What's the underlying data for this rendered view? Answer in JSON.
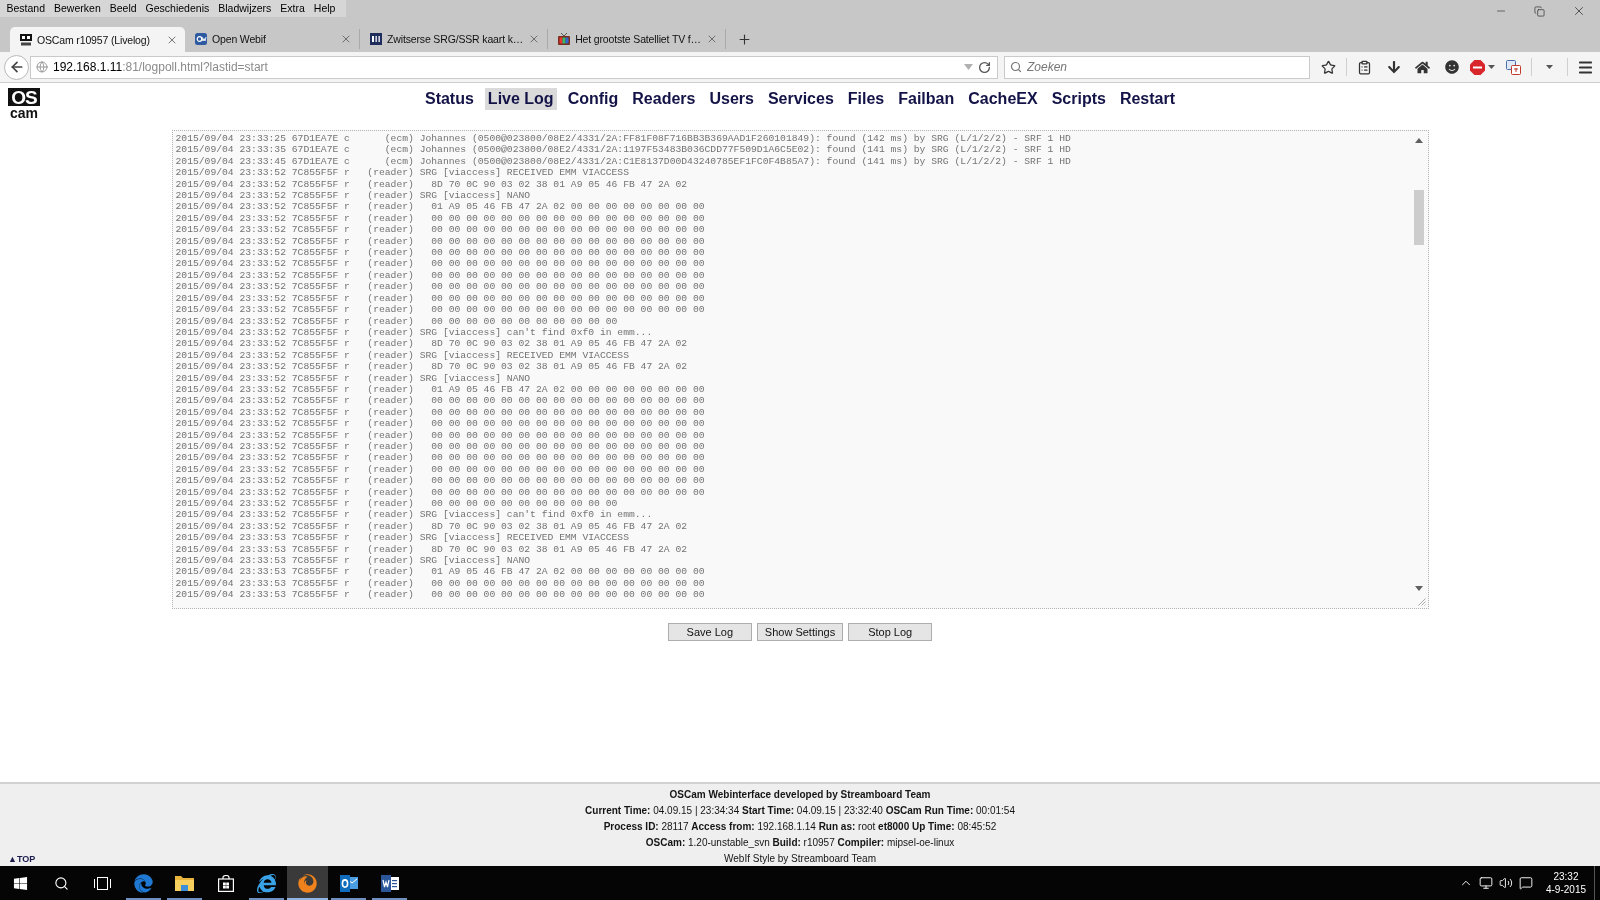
{
  "menu_bar": [
    "Bestand",
    "Bewerken",
    "Beeld",
    "Geschiedenis",
    "Bladwijzers",
    "Extra",
    "Help"
  ],
  "tabs": [
    {
      "title": "OSCam r10957 (Livelog)",
      "kind": "oscam",
      "selected": true
    },
    {
      "title": "Open Webif",
      "kind": "webif",
      "selected": false
    },
    {
      "title": "Zwitserse SRG/SSR kaart k…",
      "kind": "pli",
      "selected": false
    },
    {
      "title": "Het grootste Satelliet TV f…",
      "kind": "tv",
      "selected": false
    }
  ],
  "address_bar": {
    "host": "192.168.1.11",
    "rest": ":81/logpoll.html?lastid=start"
  },
  "search": {
    "placeholder": "Zoeken"
  },
  "logo": {
    "top": "OS",
    "bottom": "cam"
  },
  "nav": [
    {
      "label": "Status",
      "selected": false
    },
    {
      "label": "Live Log",
      "selected": true
    },
    {
      "label": "Config",
      "selected": false
    },
    {
      "label": "Readers",
      "selected": false
    },
    {
      "label": "Users",
      "selected": false
    },
    {
      "label": "Services",
      "selected": false
    },
    {
      "label": "Files",
      "selected": false
    },
    {
      "label": "Failban",
      "selected": false
    },
    {
      "label": "CacheEX",
      "selected": false
    },
    {
      "label": "Scripts",
      "selected": false
    },
    {
      "label": "Restart",
      "selected": false
    }
  ],
  "log": {
    "lines": [
      "2015/09/04 23:33:25 67D1EA7E c      (ecm) Johannes (0500@023800/08E2/4331/2A:FF81F08F716BB3B369AAD1F260101849): found (142 ms) by SRG (L/1/2/2) - SRF 1 HD",
      "2015/09/04 23:33:35 67D1EA7E c      (ecm) Johannes (0500@023800/08E2/4331/2A:1197F53483B036CDD77F509D1A6C5E02): found (141 ms) by SRG (L/1/2/2) - SRF 1 HD",
      "2015/09/04 23:33:45 67D1EA7E c      (ecm) Johannes (0500@023800/08E2/4331/2A:C1E8137D00D43240785EF1FC0F4B85A7): found (141 ms) by SRG (L/1/2/2) - SRF 1 HD",
      "2015/09/04 23:33:52 7C855F5F r   (reader) SRG [viaccess] RECEIVED EMM VIACCESS",
      "2015/09/04 23:33:52 7C855F5F r   (reader)   8D 70 0C 90 03 02 38 01 A9 05 46 FB 47 2A 02",
      "2015/09/04 23:33:52 7C855F5F r   (reader) SRG [viaccess] NANO",
      "2015/09/04 23:33:52 7C855F5F r   (reader)   01 A9 05 46 FB 47 2A 02 00 00 00 00 00 00 00 00",
      "2015/09/04 23:33:52 7C855F5F r   (reader)   00 00 00 00 00 00 00 00 00 00 00 00 00 00 00 00",
      "2015/09/04 23:33:52 7C855F5F r   (reader)   00 00 00 00 00 00 00 00 00 00 00 00 00 00 00 00",
      "2015/09/04 23:33:52 7C855F5F r   (reader)   00 00 00 00 00 00 00 00 00 00 00 00 00 00 00 00",
      "2015/09/04 23:33:52 7C855F5F r   (reader)   00 00 00 00 00 00 00 00 00 00 00 00 00 00 00 00",
      "2015/09/04 23:33:52 7C855F5F r   (reader)   00 00 00 00 00 00 00 00 00 00 00 00 00 00 00 00",
      "2015/09/04 23:33:52 7C855F5F r   (reader)   00 00 00 00 00 00 00 00 00 00 00 00 00 00 00 00",
      "2015/09/04 23:33:52 7C855F5F r   (reader)   00 00 00 00 00 00 00 00 00 00 00 00 00 00 00 00",
      "2015/09/04 23:33:52 7C855F5F r   (reader)   00 00 00 00 00 00 00 00 00 00 00 00 00 00 00 00",
      "2015/09/04 23:33:52 7C855F5F r   (reader)   00 00 00 00 00 00 00 00 00 00 00 00 00 00 00 00",
      "2015/09/04 23:33:52 7C855F5F r   (reader)   00 00 00 00 00 00 00 00 00 00 00",
      "2015/09/04 23:33:52 7C855F5F r   (reader) SRG [viaccess] can't find 0xf0 in emm...",
      "2015/09/04 23:33:52 7C855F5F r   (reader)   8D 70 0C 90 03 02 38 01 A9 05 46 FB 47 2A 02",
      "2015/09/04 23:33:52 7C855F5F r   (reader) SRG [viaccess] RECEIVED EMM VIACCESS",
      "2015/09/04 23:33:52 7C855F5F r   (reader)   8D 70 0C 90 03 02 38 01 A9 05 46 FB 47 2A 02",
      "2015/09/04 23:33:52 7C855F5F r   (reader) SRG [viaccess] NANO",
      "2015/09/04 23:33:52 7C855F5F r   (reader)   01 A9 05 46 FB 47 2A 02 00 00 00 00 00 00 00 00",
      "2015/09/04 23:33:52 7C855F5F r   (reader)   00 00 00 00 00 00 00 00 00 00 00 00 00 00 00 00",
      "2015/09/04 23:33:52 7C855F5F r   (reader)   00 00 00 00 00 00 00 00 00 00 00 00 00 00 00 00",
      "2015/09/04 23:33:52 7C855F5F r   (reader)   00 00 00 00 00 00 00 00 00 00 00 00 00 00 00 00",
      "2015/09/04 23:33:52 7C855F5F r   (reader)   00 00 00 00 00 00 00 00 00 00 00 00 00 00 00 00",
      "2015/09/04 23:33:52 7C855F5F r   (reader)   00 00 00 00 00 00 00 00 00 00 00 00 00 00 00 00",
      "2015/09/04 23:33:52 7C855F5F r   (reader)   00 00 00 00 00 00 00 00 00 00 00 00 00 00 00 00",
      "2015/09/04 23:33:52 7C855F5F r   (reader)   00 00 00 00 00 00 00 00 00 00 00 00 00 00 00 00",
      "2015/09/04 23:33:52 7C855F5F r   (reader)   00 00 00 00 00 00 00 00 00 00 00 00 00 00 00 00",
      "2015/09/04 23:33:52 7C855F5F r   (reader)   00 00 00 00 00 00 00 00 00 00 00 00 00 00 00 00",
      "2015/09/04 23:33:52 7C855F5F r   (reader)   00 00 00 00 00 00 00 00 00 00 00",
      "2015/09/04 23:33:52 7C855F5F r   (reader) SRG [viaccess] can't find 0xf0 in emm...",
      "2015/09/04 23:33:52 7C855F5F r   (reader)   8D 70 0C 90 03 02 38 01 A9 05 46 FB 47 2A 02",
      "2015/09/04 23:33:53 7C855F5F r   (reader) SRG [viaccess] RECEIVED EMM VIACCESS",
      "2015/09/04 23:33:53 7C855F5F r   (reader)   8D 70 0C 90 03 02 38 01 A9 05 46 FB 47 2A 02",
      "2015/09/04 23:33:53 7C855F5F r   (reader) SRG [viaccess] NANO",
      "2015/09/04 23:33:53 7C855F5F r   (reader)   01 A9 05 46 FB 47 2A 02 00 00 00 00 00 00 00 00",
      "2015/09/04 23:33:53 7C855F5F r   (reader)   00 00 00 00 00 00 00 00 00 00 00 00 00 00 00 00",
      "2015/09/04 23:33:53 7C855F5F r   (reader)   00 00 00 00 00 00 00 00 00 00 00 00 00 00 00 00"
    ]
  },
  "buttons": [
    "Save Log",
    "Show Settings",
    "Stop Log"
  ],
  "footer": {
    "title": "OSCam Webinterface developed by Streamboard Team",
    "details": [
      "**Current Time:** 04.09.15 | 23:34:34 **Start Time:** 04.09.15 | 23:32:40 **OSCam Run Time:** 00:01:54",
      "**Process ID:** 28117 **Access from:** 192.168.1.14 **Run as:** root **et8000 Up Time:** 08:45:52",
      "**OSCam:** 1.20-unstable_svn **Build:** r10957 **Compiler:** mipsel-oe-linux"
    ],
    "top_link": "▲TOP",
    "credit": "WebIf Style by Streamboard Team"
  },
  "taskbar": {
    "apps": [
      {
        "kind": "edge",
        "selected": false,
        "running": true
      },
      {
        "kind": "explorer",
        "selected": false,
        "running": true
      },
      {
        "kind": "store",
        "selected": false,
        "running": false
      },
      {
        "kind": "ie",
        "selected": false,
        "running": true
      },
      {
        "kind": "firefox",
        "selected": true,
        "running": true
      },
      {
        "kind": "mail",
        "selected": false,
        "running": true
      },
      {
        "kind": "word",
        "selected": false,
        "running": true
      }
    ],
    "time": "23:32",
    "date": "4-9-2015"
  }
}
